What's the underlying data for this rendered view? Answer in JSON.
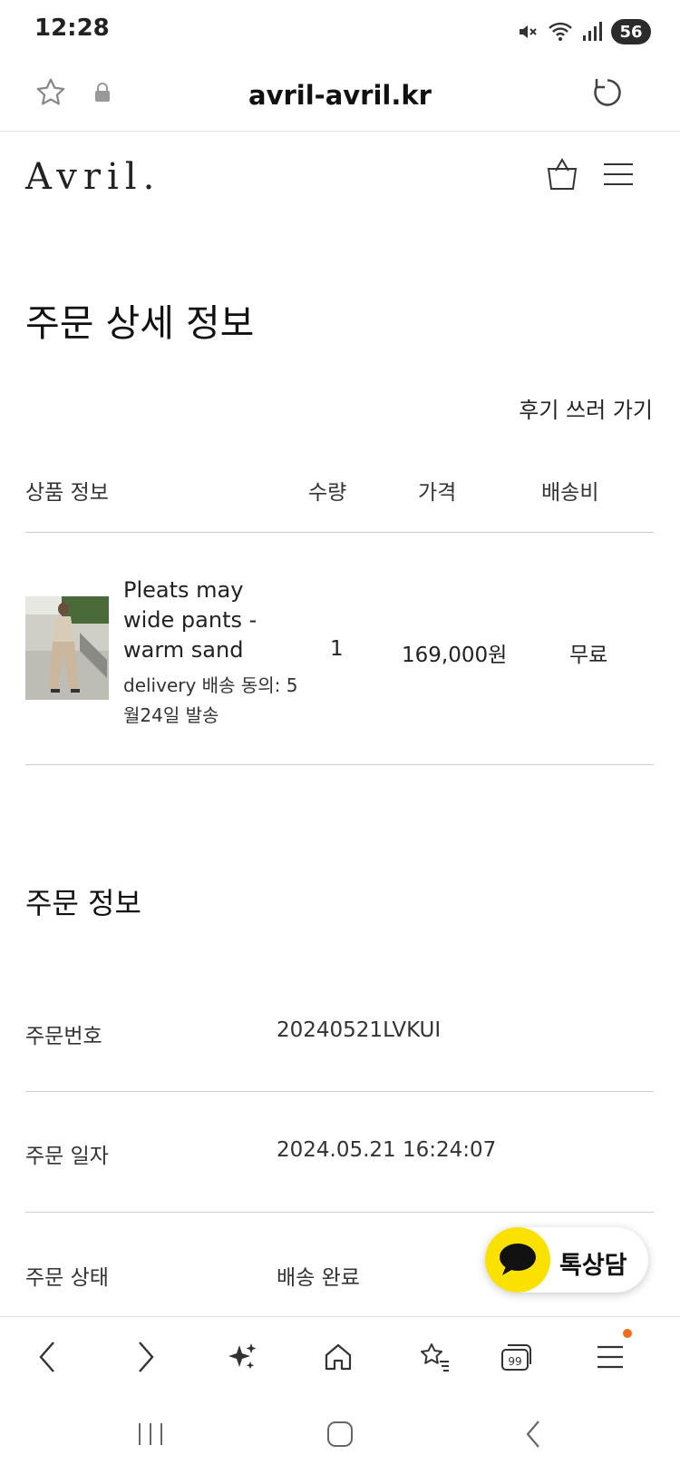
{
  "status_bar": {
    "time": "12:28",
    "battery": "56"
  },
  "browser": {
    "url": "avril-avril.kr"
  },
  "site": {
    "logo": "Avril."
  },
  "page": {
    "title": "주문 상세 정보",
    "review_link": "후기 쓰러 가기"
  },
  "table": {
    "headers": [
      "상품 정보",
      "수량",
      "가격",
      "배송비"
    ],
    "rows": [
      {
        "name": "Pleats may wide pants - warm sand",
        "option": "delivery 배송 동의: 5월24일 발송",
        "qty": "1",
        "price": "169,000원",
        "shipping": "무료"
      }
    ]
  },
  "order_info": {
    "title": "주문 정보",
    "fields": [
      {
        "label": "주문번호",
        "value": "20240521LVKUI"
      },
      {
        "label": "주문 일자",
        "value": "2024.05.21 16:24:07"
      },
      {
        "label": "주문 상태",
        "value": "배송 완료"
      }
    ]
  },
  "chat_button": {
    "label": "톡상담",
    "color": "#FAE100"
  },
  "notification_dot_color": "#F26B1D"
}
